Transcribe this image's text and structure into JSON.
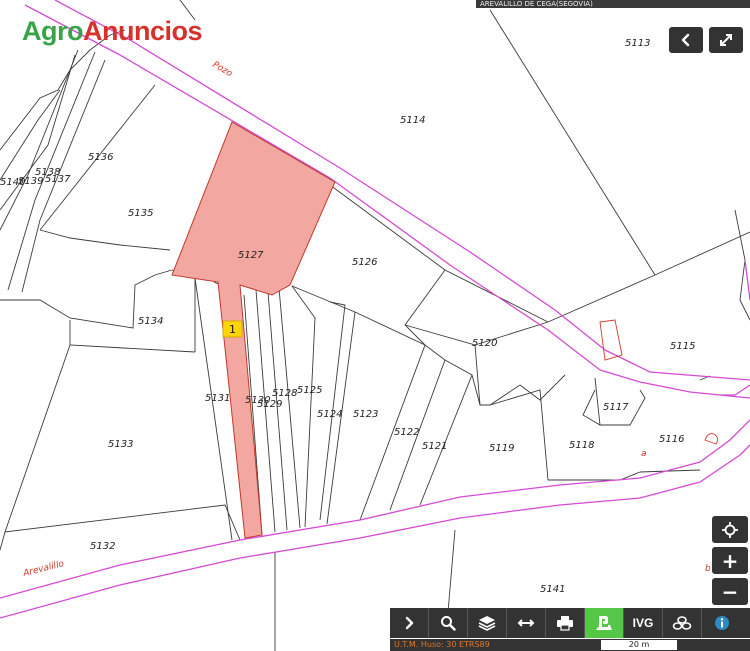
{
  "brand": {
    "part1": "Agro",
    "part2": "Anuncios"
  },
  "header": {
    "location": "AREVALILLO DE CEGA(SEGOVIA)"
  },
  "map": {
    "parcels": [
      "5113",
      "5114",
      "5136",
      "5138",
      "5139",
      "5137",
      "5140",
      "5135",
      "5127",
      "5126",
      "5134",
      "5120",
      "5115",
      "5117",
      "5116",
      "5118",
      "5119",
      "5121",
      "5122",
      "5123",
      "5124",
      "5125",
      "5128",
      "5129",
      "5130",
      "5131",
      "5133",
      "5132",
      "5141"
    ],
    "road_labels": [
      "Pozo",
      "Arevalillo"
    ],
    "misc_labels": [
      "a",
      "b"
    ],
    "marker": "1",
    "highlighted_parcel": "5127",
    "colors": {
      "highlight_fill": "#f2a8a0",
      "highlight_stroke": "#c0392b",
      "road": "#d44bd4",
      "marker": "#ffd400",
      "active_tool": "#55c746"
    }
  },
  "controls": {
    "back_icon": "chevron-left-icon",
    "fullscreen_icon": "expand-icon",
    "locate_icon": "locate-icon",
    "zoom_in_label": "+",
    "zoom_out_label": "−"
  },
  "toolbar": {
    "tools": [
      {
        "name": "chevron-right-icon"
      },
      {
        "name": "search-icon"
      },
      {
        "name": "layers-icon"
      },
      {
        "name": "measure-icon"
      },
      {
        "name": "print-icon"
      },
      {
        "name": "parcel-tool-icon",
        "active": true
      },
      {
        "name": "ivg-label",
        "label": "IVG"
      },
      {
        "name": "coins-icon"
      },
      {
        "name": "info-icon"
      }
    ]
  },
  "status": {
    "utm": "U.T.M. Huso: 30 ETRS89",
    "scale": "20 m"
  }
}
